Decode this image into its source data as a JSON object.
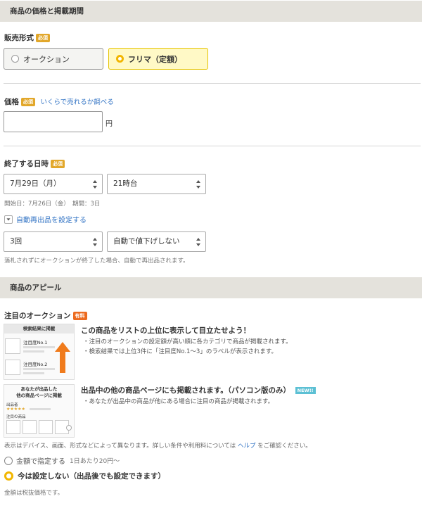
{
  "sections": {
    "price_period_title": "商品の価格と掲載期間",
    "appeal_title": "商品のアピール"
  },
  "sale_format": {
    "label": "販売形式",
    "required": "必須",
    "option_auction": "オークション",
    "option_flea": "フリマ（定額）"
  },
  "price": {
    "label": "価格",
    "required": "必須",
    "help_link": "いくらで売れるか調べる",
    "value": "",
    "unit": "円"
  },
  "end_time": {
    "label": "終了する日時",
    "required": "必須",
    "date_value": "7月29日（月）",
    "hour_value": "21時台",
    "info": "開始日：7月26日（金）　期間：3日"
  },
  "relist": {
    "toggle_label": "自動再出品を設定する",
    "count_value": "3回",
    "discount_value": "自動で値下げしない",
    "note": "落札されずにオークションが終了した場合、自動で再出品されます。"
  },
  "featured": {
    "label": "注目のオークション",
    "badge": "有料",
    "thumb1_title": "検索結果に掲載",
    "thumb1_rank1": "注目度No.1",
    "thumb1_rank2": "注目度No.2",
    "promo1_title": "この商品をリストの上位に表示して目立たせよう！",
    "promo1_line1": "・注目のオークションの設定額が高い順に各カテゴリで商品が掲載されます。",
    "promo1_line2": "・検索結果では上位3件に「注目度No.1～3」のラベルが表示されます。",
    "thumb2_title_line1": "あなたが出品した",
    "thumb2_title_line2": "他の商品ページに掲載",
    "thumb2_sub1": "出品者",
    "thumb2_stars": "★★★★★",
    "thumb2_sub2": "注目の商品",
    "promo2_title": "出品中の他の商品ページにも掲載されます。（パソコン版のみ）",
    "promo2_badge": "NEW!!",
    "promo2_line1": "・あなたが出品中の商品が他にある場合に注目の商品が掲載されます。",
    "display_note_prefix": "表示はデバイス、画面、形式などによって異なります。詳しい条件や利用料については",
    "display_note_link": "ヘルプ",
    "display_note_suffix": "をご確認ください。",
    "option_amount": "金額で指定する",
    "option_amount_rate": "1日あたり20円～",
    "option_none": "今は設定しない（出品後でも設定できます）",
    "tax_note": "金額は税抜価格です。"
  },
  "colors": {
    "section_bg": "#e4e2dc",
    "required_badge": "#e2a72a",
    "paid_badge": "#ec6a1e",
    "selected_bg": "#fff9c6",
    "link": "#3173c4",
    "arrow": "#f07b1c",
    "new_badge": "#5cc0d4"
  }
}
